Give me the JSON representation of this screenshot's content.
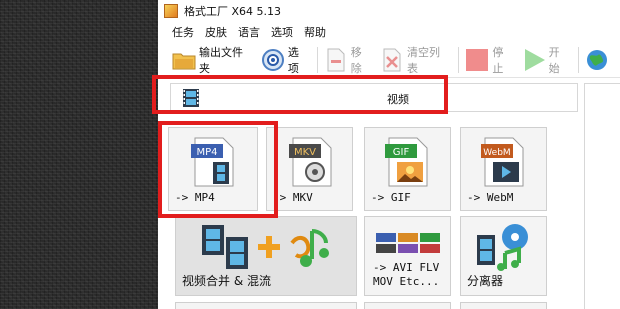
{
  "app": {
    "title": "格式工厂 X64 5.13"
  },
  "menu": [
    "任务",
    "皮肤",
    "语言",
    "选项",
    "帮助"
  ],
  "toolbar": {
    "output_folder": "输出文件夹",
    "options": "选项",
    "remove": "移除",
    "clear_list": "清空列表",
    "stop": "停止",
    "start": "开始"
  },
  "category": {
    "label": "视频"
  },
  "tiles": {
    "mp4": {
      "badge": "MP4",
      "label": "-> MP4"
    },
    "mkv": {
      "badge": "MKV",
      "label": "-> MKV"
    },
    "gif": {
      "badge": "GIF",
      "label": "-> GIF"
    },
    "webm": {
      "badge": "WebM",
      "label": "-> WebM"
    },
    "merge": {
      "label": "视频合并 & 混流"
    },
    "avi": {
      "line1": "-> AVI FLV",
      "line2": "MOV Etc..."
    },
    "splitter": {
      "label": "分离器"
    }
  },
  "colors": {
    "highlight_box": "#e21d1d",
    "mp4_badge": "#3b5fb0",
    "mkv_badge": "#4a4a4a",
    "gif_badge": "#2f9a3e",
    "webm_badge": "#c25a1e"
  },
  "icons": {
    "folder": "folder-icon",
    "options": "options-icon",
    "remove": "remove-icon",
    "clear": "clear-list-icon",
    "stop": "stop-icon",
    "start": "play-icon",
    "globe": "globe-icon",
    "film": "film-icon"
  }
}
